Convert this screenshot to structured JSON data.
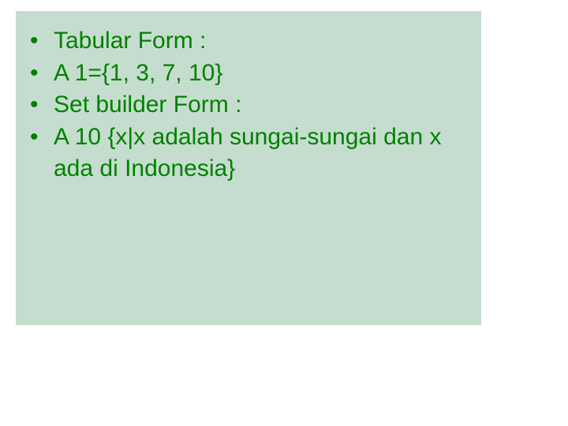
{
  "bullets": [
    {
      "text": "Tabular Form :"
    },
    {
      "text": "A 1={1, 3, 7, 10}"
    },
    {
      "text": "Set builder Form :"
    },
    {
      "text": "A 10 {x|x adalah sungai-sungai dan x ada di Indonesia}"
    }
  ]
}
